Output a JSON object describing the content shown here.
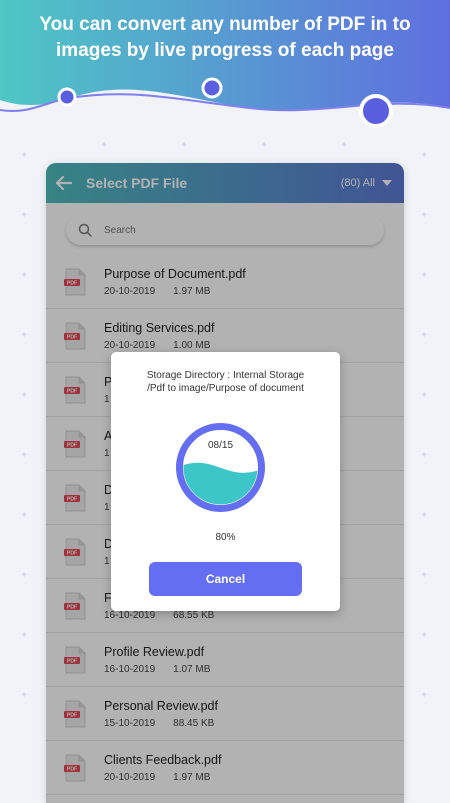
{
  "banner": {
    "line1": "You can convert any number of PDF in to",
    "line2": "images by live progress of each page"
  },
  "appbar": {
    "title": "Select PDF File",
    "count_label": "(80) All"
  },
  "search": {
    "placeholder": "Search"
  },
  "files": [
    {
      "name": "Purpose of Document.pdf",
      "date": "20-10-2019",
      "size": "1.97 MB"
    },
    {
      "name": "Editing Services.pdf",
      "date": "20-10-2019",
      "size": "1.00 MB"
    },
    {
      "name": "P",
      "date": "1",
      "size": ""
    },
    {
      "name": "A",
      "date": "1",
      "size": ""
    },
    {
      "name": "D",
      "date": "1",
      "size": ""
    },
    {
      "name": "D",
      "date": "1",
      "size": ""
    },
    {
      "name": "F",
      "date": "16-10-2019",
      "size": "68.55 KB"
    },
    {
      "name": "Profile Review.pdf",
      "date": "16-10-2019",
      "size": "1.07 MB"
    },
    {
      "name": "Personal Review.pdf",
      "date": "15-10-2019",
      "size": "88.45 KB"
    },
    {
      "name": "Clients Feedback.pdf",
      "date": "20-10-2019",
      "size": "1.97 MB"
    }
  ],
  "pdf_icon_label": "PDF",
  "dialog": {
    "directory_line1": "Storage Directory : Internal Storage",
    "directory_line2": "/Pdf to image/Purpose of document",
    "pages": "08/15",
    "percent": "80%",
    "progress": 0.8,
    "cancel_label": "Cancel"
  },
  "colors": {
    "accent": "#636ef2",
    "appbar_start": "#4fbdbe",
    "appbar_end": "#5e79d6",
    "ring": "#636ef2",
    "wave": "#3dc6c8"
  }
}
